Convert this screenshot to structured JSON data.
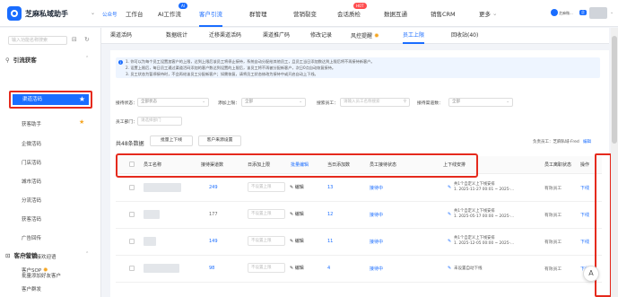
{
  "topbar": {
    "app_name": "芝麻私域助手",
    "official": "公众号",
    "nav": [
      "工作台",
      "AI工作流",
      "客户引流",
      "群管理",
      "营销裂变",
      "会话质检",
      "数据互通",
      "销售CRM",
      "更多"
    ],
    "nav_badges": {
      "ai": "AI",
      "hot": "HOT"
    },
    "more_caret": "⌄",
    "user_name": "芝麻微...",
    "user_tag": "企"
  },
  "sidebar": {
    "search_placeholder": "输入功能名称搜索",
    "groups": [
      {
        "label": "引流获客",
        "items": [
          "渠道活码",
          "获客助手",
          "企微活码",
          "门店活码",
          "城市活码",
          "分流活码",
          "获客活码",
          "广告回传",
          "好友承接欢迎语",
          "批量添加好友客户"
        ]
      },
      {
        "label": "客户营销",
        "items": [
          "客户SOP",
          "客户群发"
        ]
      }
    ],
    "active_item": "渠道活码"
  },
  "tabs": [
    "渠道活码",
    "数据统计",
    "迁移渠道活码",
    "渠道推广码",
    "修改记录",
    "风控提醒",
    "员工上限",
    "回收站(40)"
  ],
  "active_tab": "员工上限",
  "notice": {
    "lines": [
      "1. 你可以为每个员工设置加客户的上限，达到上限后该员工将停止接待，系统自动分配给其他员工，且员工当日添加数达到上限后将不再接待新客户。",
      "2. 设置上限后，每日员工通过渠道活码添加的客户数达到设置的上限后，该员工将不再被分配新客户，次日0点自动恢复接待。",
      "3. 员工状态为暂停接待时，不会再给该员工分配新客户；如需恢复，请将员工状态修改为接待中或开启自动上下线。"
    ]
  },
  "filters": {
    "status_label": "接待状态：",
    "status_value": "全部状态",
    "limit_label": "添加上限：",
    "limit_value": "全部",
    "search_label": "搜索员工：",
    "search_placeholder": "请输入员工名称搜索",
    "channel_label": "接待渠道数：",
    "channel_value": "全部",
    "dept_label": "员工部门：",
    "dept_placeholder": "请选择部门"
  },
  "toolbar": {
    "total": "共48条数据",
    "batch_online": "批量上下线",
    "source_setting": "客户来源设置",
    "responsible_label": "负责员工：芝麻私域-Fred",
    "responsible_edit": "编辑"
  },
  "table": {
    "headers": [
      "员工名称",
      "接待渠道数",
      "日添加上限",
      "批量编辑",
      "当日添加数",
      "员工接待状态",
      "上下线安排",
      "员工离职状态",
      "操作"
    ],
    "input_placeholder": "不设置上限",
    "edit_label": "编辑",
    "rows": [
      {
        "channels": "249",
        "today": "13",
        "status": "接待中",
        "schedule": [
          "共1个自定义上下线安排",
          "1. 2025-11-27 00:01 ~ 2025-..."
        ],
        "resign": "有效员工",
        "op": "下线"
      },
      {
        "channels": "177",
        "today": "12",
        "status": "接待中",
        "schedule": [
          "共1个自定义上下线安排",
          "1. 2025-05-17 00:00 ~ 2025-..."
        ],
        "resign": "有效员工",
        "op": "下线"
      },
      {
        "channels": "149",
        "today": "11",
        "status": "接待中",
        "schedule": [
          "共1个自定义上下线安排",
          "1. 2025-12-05 00:00 ~ 2025-..."
        ],
        "resign": "有效员工",
        "op": "下线"
      },
      {
        "channels": "98",
        "today": "4",
        "status": "接待中",
        "schedule": [
          "未设置自动下线"
        ],
        "resign": "有效员工",
        "op": "下线"
      }
    ]
  },
  "float_button": "A"
}
